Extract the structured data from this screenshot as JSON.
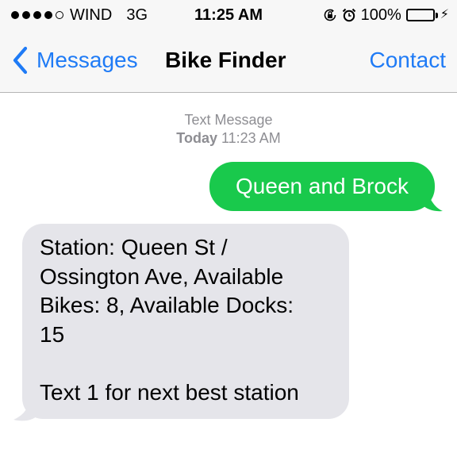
{
  "status_bar": {
    "carrier": "WIND",
    "network": "3G",
    "time": "11:25 AM",
    "battery_percent": "100%",
    "battery_level": 1.0,
    "signal_bars_filled": 4,
    "signal_bars_total": 5,
    "icons": [
      "rotation-lock-icon",
      "alarm-icon",
      "battery-icon",
      "charging-bolt-icon"
    ]
  },
  "nav": {
    "back_label": "Messages",
    "title": "Bike Finder",
    "right_label": "Contact"
  },
  "thread": {
    "service_label": "Text Message",
    "timestamp_day": "Today",
    "timestamp_time": "11:23 AM",
    "messages": [
      {
        "direction": "outgoing",
        "text": "Queen and Brock"
      },
      {
        "direction": "incoming",
        "text": "Station: Queen St /\nOssington Ave, Available\nBikes: 8, Available Docks:\n15\n\nText 1 for next best station"
      }
    ]
  },
  "colors": {
    "ios_blue": "#1f7bf6",
    "sms_green": "#19c94c",
    "incoming_gray": "#e5e5ea",
    "battery_green": "#4cd964",
    "timestamp_gray": "#8e8e93"
  }
}
